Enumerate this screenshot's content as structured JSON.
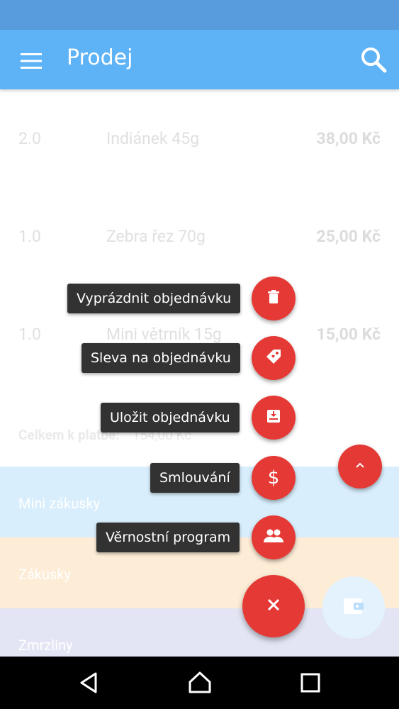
{
  "app_bar": {
    "title": "Prodej",
    "menu_icon": "hamburger-menu-icon",
    "search_icon": "search-icon",
    "color": "#2196f3",
    "status_color": "#1976d2"
  },
  "order_items": [
    {
      "qty": "2.0",
      "name": "Indiánek 45g",
      "price": "38,00 Kč"
    },
    {
      "qty": "1.0",
      "name": "Zebra řez 70g",
      "price": "25,00 Kč"
    },
    {
      "qty": "1.0",
      "name": "Mini větrník 15g",
      "price": "15,00 Kč"
    }
  ],
  "total": {
    "label": "Celkem k platbě:",
    "value": "154,00 Kč"
  },
  "categories": [
    {
      "label": "Mini zákusky",
      "color": "#c9e8fb"
    },
    {
      "label": "Zákusky",
      "color": "#fde5c6"
    },
    {
      "label": "Zmrzliny",
      "color": "#d8dbf0"
    }
  ],
  "speed_dial": [
    {
      "label": "Vyprázdnit objednávku",
      "icon": "trash-icon"
    },
    {
      "label": "Sleva na objednávku",
      "icon": "tag-icon"
    },
    {
      "label": "Uložit objednávku",
      "icon": "save-box-icon"
    },
    {
      "label": "Smlouvání",
      "icon": "dollar-icon"
    },
    {
      "label": "Věrnostní program",
      "icon": "people-icon"
    }
  ],
  "fab_color": "#e53935",
  "main_fab_icon": "close-icon",
  "scroll_up_icon": "chevron-up-icon",
  "wallet_icon": "wallet-icon",
  "nav": {
    "back_icon": "back-icon",
    "home_icon": "home-icon",
    "recents_icon": "recents-icon"
  }
}
